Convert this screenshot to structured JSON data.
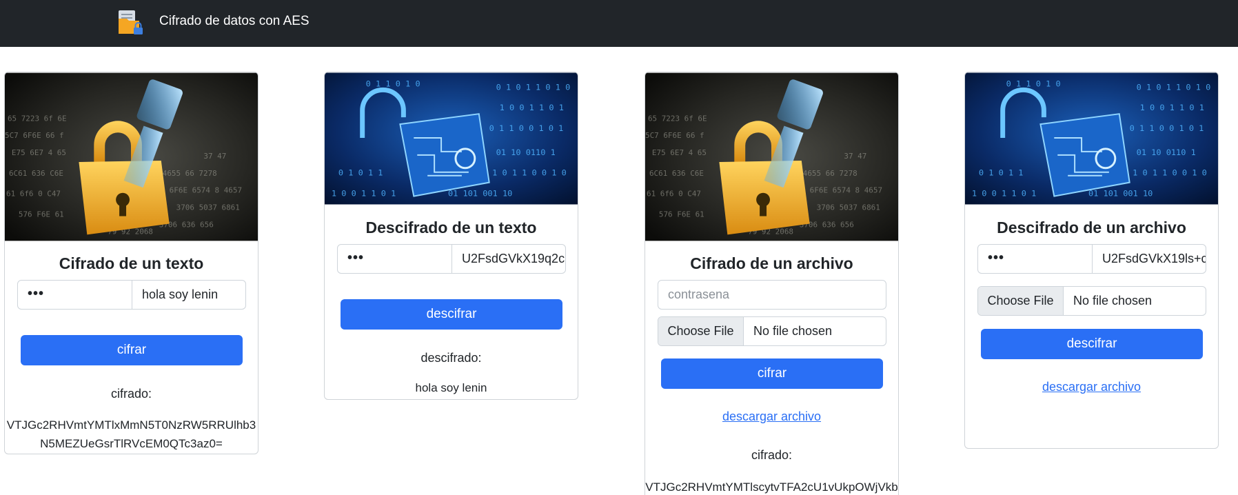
{
  "navbar": {
    "brand_icon": "folder-lock-icon",
    "title": "Cifrado de datos con AES"
  },
  "cards": {
    "encrypt_text": {
      "image": "golden-padlock-key-image",
      "title": "Cifrado de un texto",
      "password_value": "•••",
      "text_value": "hola soy lenin",
      "button_label": "cifrar",
      "result_label": "cifrado:",
      "result_value": "VTJGc2RHVmtYMTlxMmN5T0NzRW5RRUlhb3\nN5MEZUeGsrTlRVcEM0QTc3az0="
    },
    "decrypt_text": {
      "image": "blue-open-padlock-image",
      "title": "Descifrado de un texto",
      "password_value": "•••",
      "text_value": "U2FsdGVkX19q2c",
      "button_label": "descifrar",
      "result_label": "descifrado:",
      "result_value": "hola soy lenin"
    },
    "encrypt_file": {
      "image": "golden-padlock-key-image",
      "title": "Cifrado de un archivo",
      "password_placeholder": "contrasena",
      "file_button": "Choose File",
      "file_status": "No file chosen",
      "button_label": "cifrar",
      "download_link": "descargar archivo",
      "result_label": "cifrado:",
      "result_value": "VTJGc2RHVmtYMTlscytvTFA2cU1vUkpOWjVkb"
    },
    "decrypt_file": {
      "image": "blue-open-padlock-image",
      "title": "Descifrado de un archivo",
      "password_value": "•••",
      "text_value": "U2FsdGVkX19ls+c",
      "file_button": "Choose File",
      "file_status": "No file chosen",
      "button_label": "descifrar",
      "download_link": "descargar archivo"
    }
  },
  "colors": {
    "navbar": "#212529",
    "primary": "#2a6ff5",
    "gold": "#f2b632",
    "blue_glow": "#3aa6ff"
  }
}
